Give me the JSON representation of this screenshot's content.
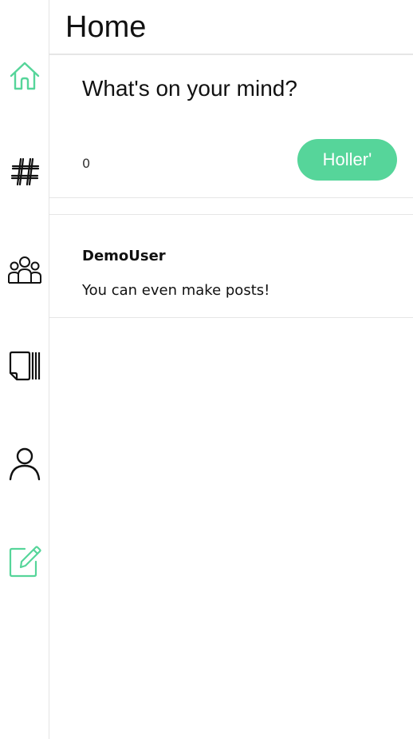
{
  "nav": [
    {
      "name": "home-icon",
      "color": "#56d59a"
    },
    {
      "name": "hashtag-icon",
      "color": "#111111"
    },
    {
      "name": "people-group-icon",
      "color": "#111111"
    },
    {
      "name": "cards-stack-icon",
      "color": "#111111"
    },
    {
      "name": "user-profile-icon",
      "color": "#111111"
    },
    {
      "name": "edit-compose-icon",
      "color": "#56d59a"
    }
  ],
  "header": {
    "title": "Home"
  },
  "composer": {
    "placeholder": "What's on your mind?",
    "char_count": "0",
    "submit_label": "Holler'",
    "accent_color": "#56d59a"
  },
  "posts": [
    {
      "author": "DemoUser",
      "body": "You can even make posts!"
    }
  ]
}
